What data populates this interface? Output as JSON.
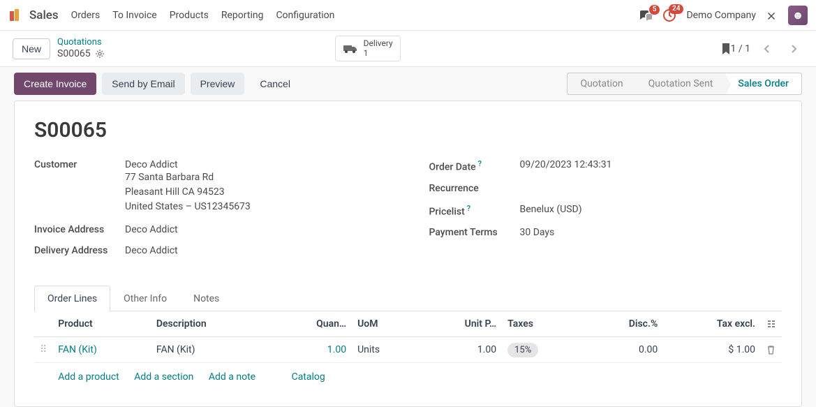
{
  "topnav": {
    "app": "Sales",
    "menus": [
      "Orders",
      "To Invoice",
      "Products",
      "Reporting",
      "Configuration"
    ],
    "chat_badge": "5",
    "activity_badge": "24",
    "company": "Demo Company"
  },
  "breadcrumb": {
    "new_btn": "New",
    "parent": "Quotations",
    "current": "S00065",
    "stat_label": "Delivery",
    "stat_value": "1",
    "pager": "1 / 1"
  },
  "actions": {
    "create_invoice": "Create Invoice",
    "send_email": "Send by Email",
    "preview": "Preview",
    "cancel": "Cancel"
  },
  "status": {
    "steps": [
      "Quotation",
      "Quotation Sent",
      "Sales Order"
    ],
    "active_index": 2
  },
  "order": {
    "name": "S00065",
    "customer_label": "Customer",
    "customer_name": "Deco Addict",
    "addr1": "77 Santa Barbara Rd",
    "addr2": "Pleasant Hill CA 94523",
    "addr3": "United States – US12345673",
    "invoice_addr_label": "Invoice Address",
    "invoice_addr_value": "Deco Addict",
    "delivery_addr_label": "Delivery Address",
    "delivery_addr_value": "Deco Addict",
    "order_date_label": "Order Date",
    "order_date_value": "09/20/2023 12:43:31",
    "recurrence_label": "Recurrence",
    "pricelist_label": "Pricelist",
    "pricelist_value": "Benelux (USD)",
    "payment_terms_label": "Payment Terms",
    "payment_terms_value": "30 Days"
  },
  "tabs": [
    "Order Lines",
    "Other Info",
    "Notes"
  ],
  "table": {
    "headers": {
      "product": "Product",
      "description": "Description",
      "quantity": "Quan…",
      "uom": "UoM",
      "unit_price": "Unit P…",
      "taxes": "Taxes",
      "disc": "Disc.%",
      "tax_excl": "Tax excl."
    },
    "row": {
      "product": "FAN (Kit)",
      "description": "FAN (Kit)",
      "quantity": "1.00",
      "uom": "Units",
      "unit_price": "1.00",
      "taxes": "15%",
      "disc": "0.00",
      "tax_excl": "$ 1.00"
    },
    "add_product": "Add a product",
    "add_section": "Add a section",
    "add_note": "Add a note",
    "catalog": "Catalog"
  }
}
